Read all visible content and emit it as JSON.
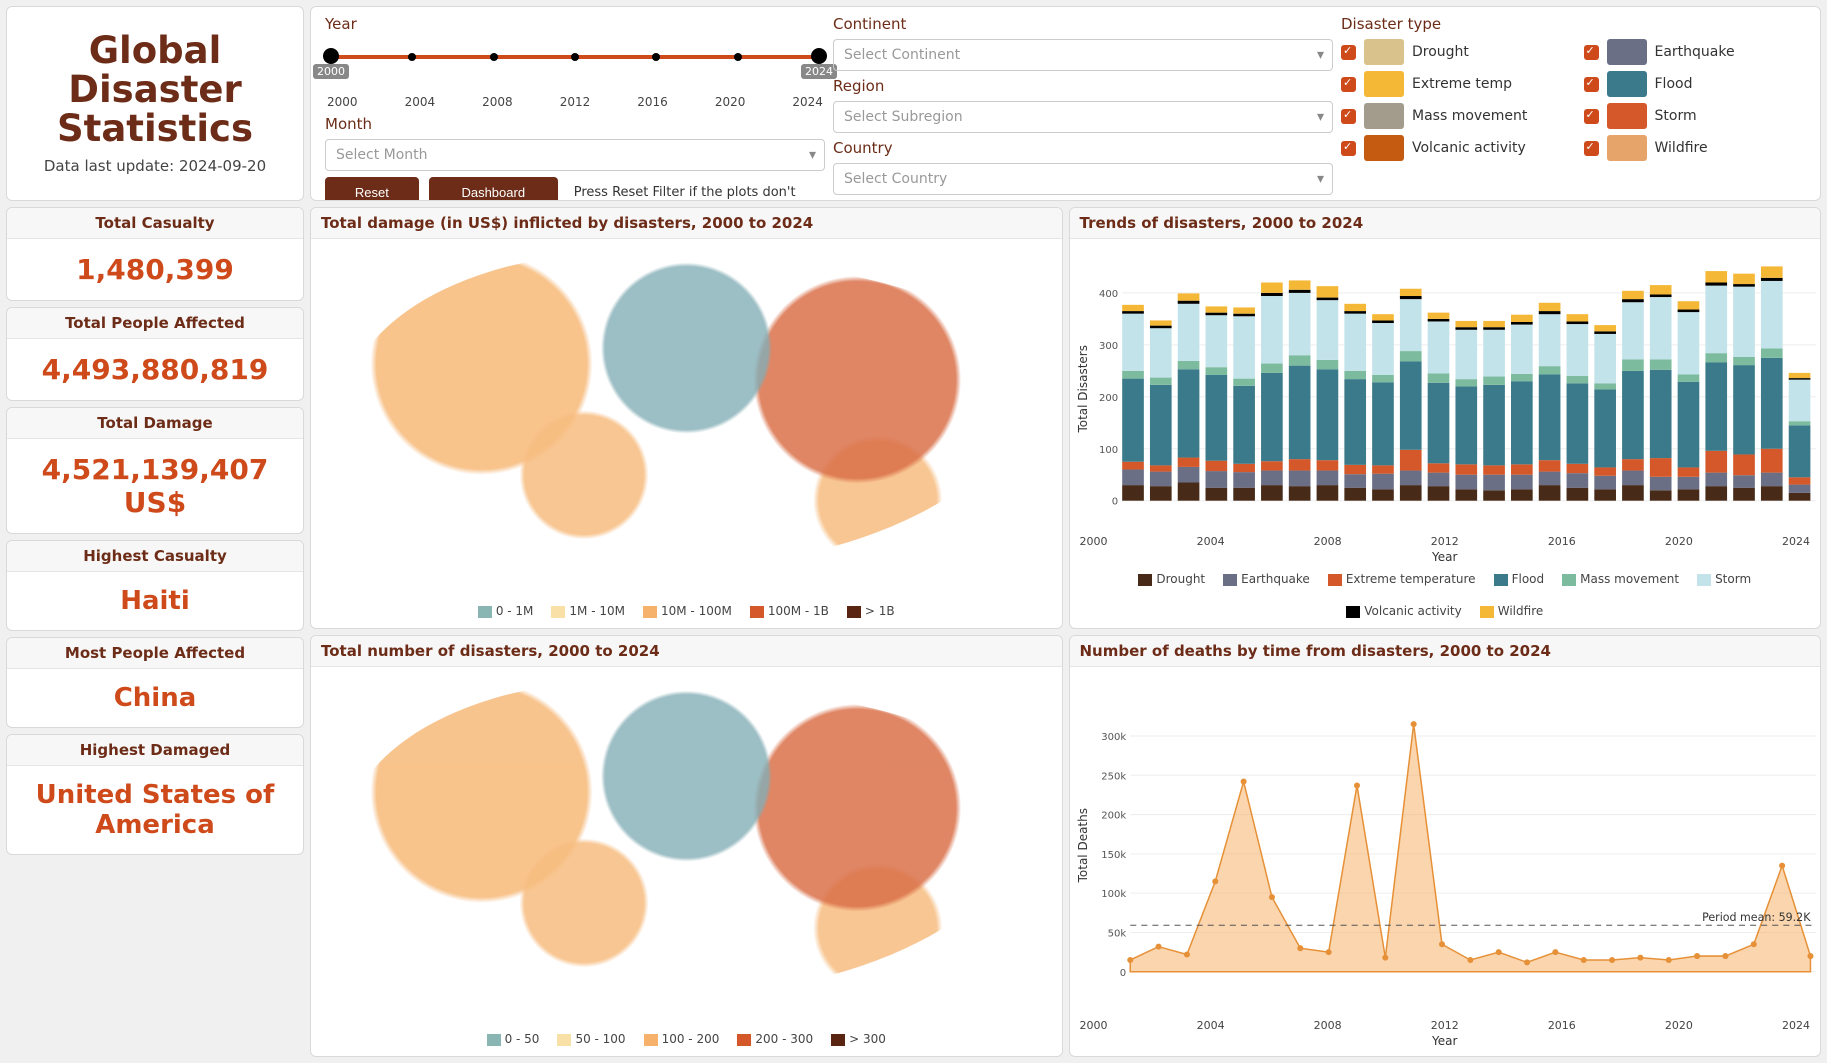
{
  "title": "Global Disaster Statistics",
  "updated_label": "Data last update: 2024-09-20",
  "controls": {
    "year_label": "Year",
    "year_ticks": [
      "2000",
      "2004",
      "2008",
      "2012",
      "2016",
      "2020",
      "2024"
    ],
    "year_from": "2000",
    "year_to": "2024",
    "month_label": "Month",
    "month_placeholder": "Select Month",
    "continent_label": "Continent",
    "continent_placeholder": "Select Continent",
    "region_label": "Region",
    "region_placeholder": "Select Subregion",
    "country_label": "Country",
    "country_placeholder": "Select Country",
    "reset_btn": "Reset Filter",
    "guide_btn": "Dashboard Guide",
    "hint": "Press Reset Filter if the plots don't load",
    "types_label": "Disaster type",
    "types": [
      {
        "label": "Drought",
        "color": "#d9c28b"
      },
      {
        "label": "Earthquake",
        "color": "#6b6f86"
      },
      {
        "label": "Extreme temp",
        "color": "#f4b836"
      },
      {
        "label": "Flood",
        "color": "#3b7a8a"
      },
      {
        "label": "Mass movement",
        "color": "#a39c8d"
      },
      {
        "label": "Storm",
        "color": "#d4582a"
      },
      {
        "label": "Volcanic activity",
        "color": "#c55a11"
      },
      {
        "label": "Wildfire",
        "color": "#e6a46b"
      }
    ]
  },
  "stats": {
    "casualty_label": "Total Casualty",
    "casualty_value": "1,480,399",
    "affected_label": "Total People Affected",
    "affected_value": "4,493,880,819",
    "damage_label": "Total Damage",
    "damage_value": "4,521,139,407 US$",
    "hi_cas_label": "Highest Casualty",
    "hi_cas_value": "Haiti",
    "hi_aff_label": "Most People Affected",
    "hi_aff_value": "China",
    "hi_dmg_label": "Highest Damaged",
    "hi_dmg_value": "United States of America"
  },
  "cards": {
    "map_damage_title": "Total damage (in US$) inflicted by disasters, 2000 to 2024",
    "map_count_title": "Total number of disasters, 2000 to 2024",
    "trends_title": "Trends of disasters, 2000 to 2024",
    "deaths_title": "Number of deaths by time from disasters, 2000 to 2024"
  },
  "legends": {
    "damage_bins": [
      "0 - 1M",
      "1M - 10M",
      "10M - 100M",
      "100M - 1B",
      "> 1B"
    ],
    "count_bins": [
      "0 - 50",
      "50 - 100",
      "100 - 200",
      "200 - 300",
      "> 300"
    ],
    "trend_series": [
      "Drought",
      "Earthquake",
      "Extreme temperature",
      "Flood",
      "Mass movement",
      "Storm",
      "Volcanic activity",
      "Wildfire"
    ]
  },
  "axes": {
    "trends_y": "Total Disasters",
    "trends_x": "Year",
    "trends_y_ticks": [
      "0",
      "100",
      "200",
      "300",
      "400"
    ],
    "deaths_y": "Total Deaths",
    "deaths_x": "Year",
    "deaths_y_ticks": [
      "0",
      "50k",
      "100k",
      "150k",
      "200k",
      "250k",
      "300k"
    ],
    "x_years": [
      "2000",
      "2004",
      "2008",
      "2012",
      "2016",
      "2020",
      "2024"
    ],
    "period_mean": "Period mean: 59.2K"
  },
  "chart_data": [
    {
      "type": "bar",
      "id": "trends_stacked",
      "title": "Trends of disasters, 2000 to 2024",
      "xlabel": "Year",
      "ylabel": "Total Disasters",
      "ylim": [
        0,
        430
      ],
      "categories": [
        2000,
        2001,
        2002,
        2003,
        2004,
        2005,
        2006,
        2007,
        2008,
        2009,
        2010,
        2011,
        2012,
        2013,
        2014,
        2015,
        2016,
        2017,
        2018,
        2019,
        2020,
        2021,
        2022,
        2023,
        2024
      ],
      "series": [
        {
          "name": "Drought",
          "color": "#472b18",
          "values": [
            30,
            28,
            35,
            25,
            25,
            30,
            28,
            30,
            25,
            22,
            30,
            28,
            22,
            20,
            22,
            30,
            25,
            22,
            30,
            20,
            22,
            28,
            25,
            28,
            15
          ]
        },
        {
          "name": "Earthquake",
          "color": "#6b6f86",
          "values": [
            30,
            28,
            30,
            32,
            30,
            28,
            30,
            28,
            26,
            30,
            28,
            26,
            28,
            30,
            28,
            26,
            28,
            26,
            28,
            26,
            24,
            26,
            24,
            26,
            16
          ]
        },
        {
          "name": "Extreme temperature",
          "color": "#d4582a",
          "values": [
            15,
            12,
            18,
            20,
            16,
            18,
            22,
            20,
            18,
            16,
            40,
            18,
            20,
            18,
            20,
            22,
            18,
            16,
            22,
            36,
            18,
            42,
            40,
            46,
            14
          ]
        },
        {
          "name": "Flood",
          "color": "#3b7a8a",
          "values": [
            160,
            155,
            170,
            165,
            150,
            170,
            180,
            175,
            165,
            160,
            170,
            155,
            150,
            155,
            160,
            165,
            155,
            150,
            170,
            170,
            165,
            170,
            172,
            175,
            100
          ]
        },
        {
          "name": "Mass movement",
          "color": "#7dbb9f",
          "values": [
            15,
            14,
            16,
            15,
            14,
            18,
            20,
            18,
            16,
            14,
            20,
            18,
            14,
            16,
            14,
            16,
            14,
            12,
            22,
            20,
            14,
            18,
            16,
            18,
            8
          ]
        },
        {
          "name": "Storm",
          "color": "#c3e3ea",
          "values": [
            110,
            95,
            110,
            100,
            120,
            130,
            120,
            115,
            110,
            100,
            100,
            100,
            95,
            90,
            95,
            100,
            100,
            95,
            110,
            120,
            120,
            130,
            135,
            130,
            80
          ]
        },
        {
          "name": "Volcanic activity",
          "color": "#000000",
          "values": [
            5,
            5,
            6,
            5,
            5,
            6,
            6,
            5,
            5,
            5,
            6,
            5,
            5,
            5,
            5,
            6,
            5,
            5,
            6,
            5,
            5,
            6,
            5,
            6,
            3
          ]
        },
        {
          "name": "Wildfire",
          "color": "#f4b836",
          "values": [
            12,
            10,
            14,
            12,
            12,
            20,
            18,
            22,
            14,
            12,
            14,
            12,
            12,
            12,
            14,
            16,
            14,
            12,
            16,
            18,
            16,
            22,
            20,
            22,
            10
          ]
        }
      ]
    },
    {
      "type": "area",
      "id": "deaths_over_time",
      "title": "Number of deaths by time from disasters, 2000 to 2024",
      "xlabel": "Year",
      "ylabel": "Total Deaths",
      "ylim": [
        0,
        320000
      ],
      "period_mean": 59200,
      "x": [
        2000,
        2001,
        2002,
        2003,
        2004,
        2005,
        2006,
        2007,
        2008,
        2009,
        2010,
        2011,
        2012,
        2013,
        2014,
        2015,
        2016,
        2017,
        2018,
        2019,
        2020,
        2021,
        2022,
        2023,
        2024
      ],
      "y": [
        15000,
        32000,
        22000,
        115000,
        242000,
        95000,
        30000,
        25000,
        237000,
        18000,
        315000,
        35000,
        15000,
        25000,
        12000,
        25000,
        15000,
        15000,
        18000,
        15000,
        20000,
        20000,
        35000,
        135000,
        20000
      ]
    },
    {
      "type": "map",
      "id": "damage_choropleth",
      "title": "Total damage (in US$) inflicted by disasters, 2000 to 2024",
      "bins": [
        "0 - 1M",
        "1M - 10M",
        "10M - 100M",
        "100M - 1B",
        "> 1B"
      ]
    },
    {
      "type": "map",
      "id": "count_choropleth",
      "title": "Total number of disasters, 2000 to 2024",
      "bins": [
        "0 - 50",
        "50 - 100",
        "100 - 200",
        "200 - 300",
        "> 300"
      ]
    }
  ]
}
